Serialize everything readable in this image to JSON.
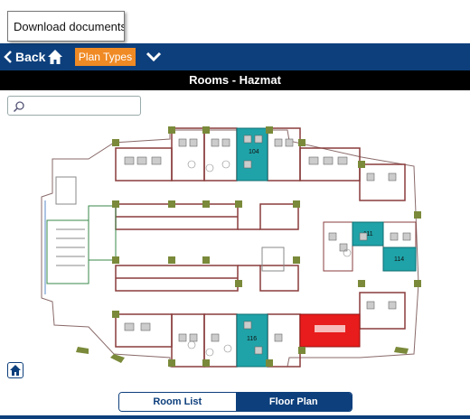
{
  "tooltip": {
    "text": "Download documents. "
  },
  "nav": {
    "back_label": "Back",
    "plan_types_label": "Plan Types"
  },
  "page": {
    "title": "Rooms - Hazmat"
  },
  "search": {
    "placeholder": ""
  },
  "rooms": {
    "r104": "104",
    "r111": "111",
    "r114": "114",
    "r116": "116"
  },
  "tabs": {
    "room_list": "Room List",
    "floor_plan": "Floor Plan",
    "active": "Floor Plan"
  },
  "colors": {
    "nav": "#0d3f7c",
    "accent": "#f08a24",
    "teal_room": "#1fa3a8",
    "red_room": "#e81c1c",
    "wall": "#8a3c3c",
    "pillar": "#7a8a3a"
  }
}
